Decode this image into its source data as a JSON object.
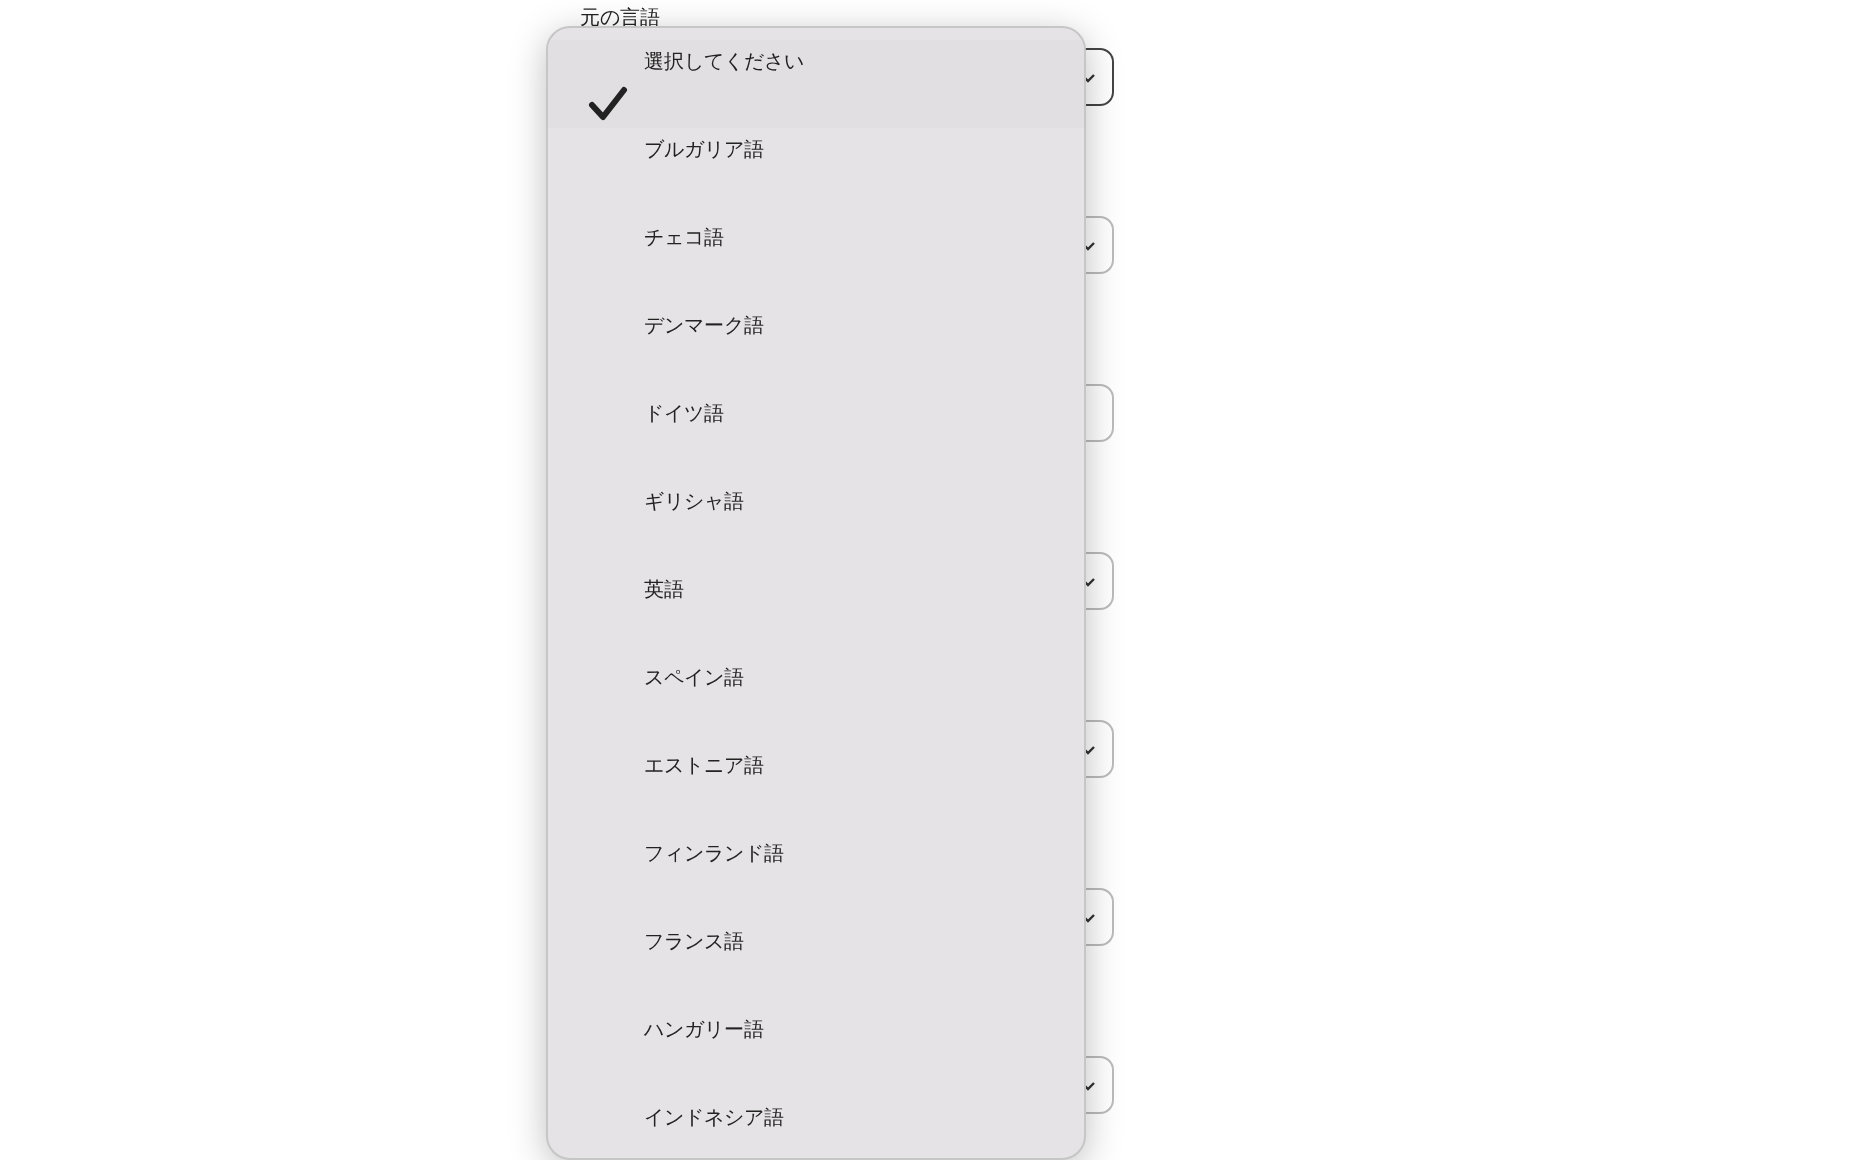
{
  "form": {
    "label": "元の言語",
    "fields": [
      {
        "kind": "select"
      },
      {
        "kind": "select"
      },
      {
        "kind": "text"
      },
      {
        "kind": "select"
      },
      {
        "kind": "select"
      },
      {
        "kind": "select"
      },
      {
        "kind": "select"
      }
    ]
  },
  "menu": {
    "items": [
      {
        "label": "選択してください",
        "selected": true
      },
      {
        "label": "ブルガリア語",
        "selected": false
      },
      {
        "label": "チェコ語",
        "selected": false
      },
      {
        "label": "デンマーク語",
        "selected": false
      },
      {
        "label": "ドイツ語",
        "selected": false
      },
      {
        "label": "ギリシャ語",
        "selected": false
      },
      {
        "label": "英語",
        "selected": false
      },
      {
        "label": "スペイン語",
        "selected": false
      },
      {
        "label": "エストニア語",
        "selected": false
      },
      {
        "label": "フィンランド語",
        "selected": false
      },
      {
        "label": "フランス語",
        "selected": false
      },
      {
        "label": "ハンガリー語",
        "selected": false
      },
      {
        "label": "インドネシア語",
        "selected": false
      }
    ]
  }
}
